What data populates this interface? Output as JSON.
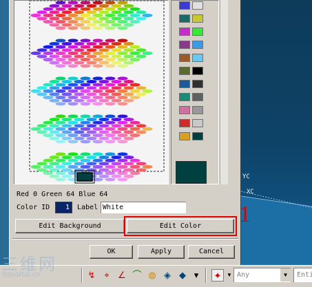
{
  "dialog": {
    "rgb_text": "Red 0 Green 64 Blue 64",
    "color_id_label": "Color ID",
    "color_id_value": "1",
    "label_label": "Label",
    "label_value": "White",
    "edit_background_label": "Edit Background",
    "edit_color_label": "Edit Color",
    "ok_label": "OK",
    "apply_label": "Apply",
    "cancel_label": "Cancel",
    "preview_color": "#004040"
  },
  "annotation": {
    "callout_number": "1",
    "highlight_color": "#e00000"
  },
  "custom_colors": [
    [
      "#3a3ad8",
      "#e0e0e0"
    ],
    [
      "#1a6a6a",
      "#c8c830"
    ],
    [
      "#c82cc8",
      "#38e838"
    ],
    [
      "#8a3a8a",
      "#3a9ae8"
    ],
    [
      "#9a5a2a",
      "#6ac8f0"
    ],
    [
      "#5a6a2a",
      "#000000"
    ],
    [
      "#1a5a9a",
      "#303030"
    ],
    [
      "#1a8a7a",
      "#606060"
    ],
    [
      "#d070a0",
      "#989898"
    ],
    [
      "#d02a2a",
      "#c8c8c8"
    ],
    [
      "#d8a020",
      "#004040"
    ]
  ],
  "viewport": {
    "axis_label_yc": "YC",
    "axis_label_xc": "XC"
  },
  "toolbar": {
    "icons": [
      "info-icon",
      "snap-icon",
      "point-icon",
      "angle-icon",
      "curve-icon",
      "surface-icon",
      "paint-icon",
      "layer-icon",
      "snap-point-icon"
    ],
    "filter_placeholder": "Any",
    "entity_placeholder": "Enti"
  },
  "watermark": {
    "text": "三维网",
    "sub": "3dportal.cn"
  }
}
